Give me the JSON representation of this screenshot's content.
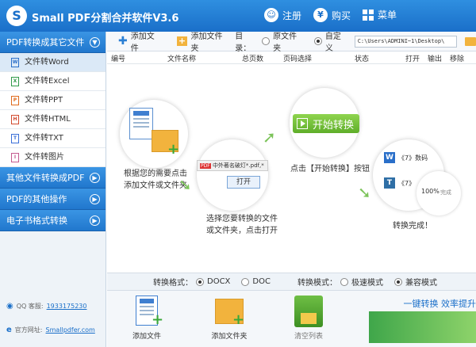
{
  "window": {
    "logo_letter": "S",
    "title": "Small PDF分割合并软件V3.6",
    "register_label": "注册",
    "buy_label": "购买",
    "menu_label": "菜单"
  },
  "sidebar": {
    "section1": "PDF转换成其它文件",
    "items": [
      {
        "label": "文件转Word",
        "icon": "W",
        "color": "#2a6fc9"
      },
      {
        "label": "文件转Excel",
        "icon": "X",
        "color": "#2f9a49"
      },
      {
        "label": "文件转PPT",
        "icon": "P",
        "color": "#e06a1c"
      },
      {
        "label": "文件转HTML",
        "icon": "H",
        "color": "#d24a2e"
      },
      {
        "label": "文件转TXT",
        "icon": "T",
        "color": "#3a6fd8"
      },
      {
        "label": "文件转图片",
        "icon": "I",
        "color": "#c45a8f"
      }
    ],
    "section2": "其他文件转换成PDF",
    "section3": "PDF的其他操作",
    "section4": "电子书格式转换",
    "qq_label": "QQ 客服:",
    "qq_value": "1933175230",
    "site_label": "官方网址:",
    "site_value": "Smallpdfer.com"
  },
  "toolbar": {
    "add_file": "添加文件",
    "add_folder": "添加文件夹",
    "directory": "目录：",
    "original_folder": "原文件夹",
    "custom": "自定义",
    "path": "C:\\Users\\ADMINI~1\\Desktop\\"
  },
  "table": {
    "headers": [
      "编号",
      "文件名称",
      "总页数",
      "页码选择",
      "状态",
      "打开",
      "输出",
      "移除"
    ]
  },
  "guide": {
    "step1": "根据您的需要点击\n添加文件或文件夹",
    "step2_filename": "中外著名破灯*.pdf,*",
    "step2_open": "打开",
    "step2": "选择您要转换的文件\n或文件夹，点击打开",
    "step3_button": "开始转换",
    "step3": "点击【开始转换】按钮",
    "step4_row1": "《7》数码",
    "step4_row2": "《7》",
    "step4_percent": "100%",
    "step4_done_chip": "完成",
    "step4": "转换完成！"
  },
  "options": {
    "format_label": "转换格式：",
    "docx": "DOCX",
    "doc": "DOC",
    "mode_label": "转换模式：",
    "fast": "极速模式",
    "compat": "兼容模式"
  },
  "bottom": {
    "add_file": "添加文件",
    "add_folder": "添加文件夹",
    "clear_list": "清空列表",
    "slogan": "一键转换  效率提升"
  }
}
